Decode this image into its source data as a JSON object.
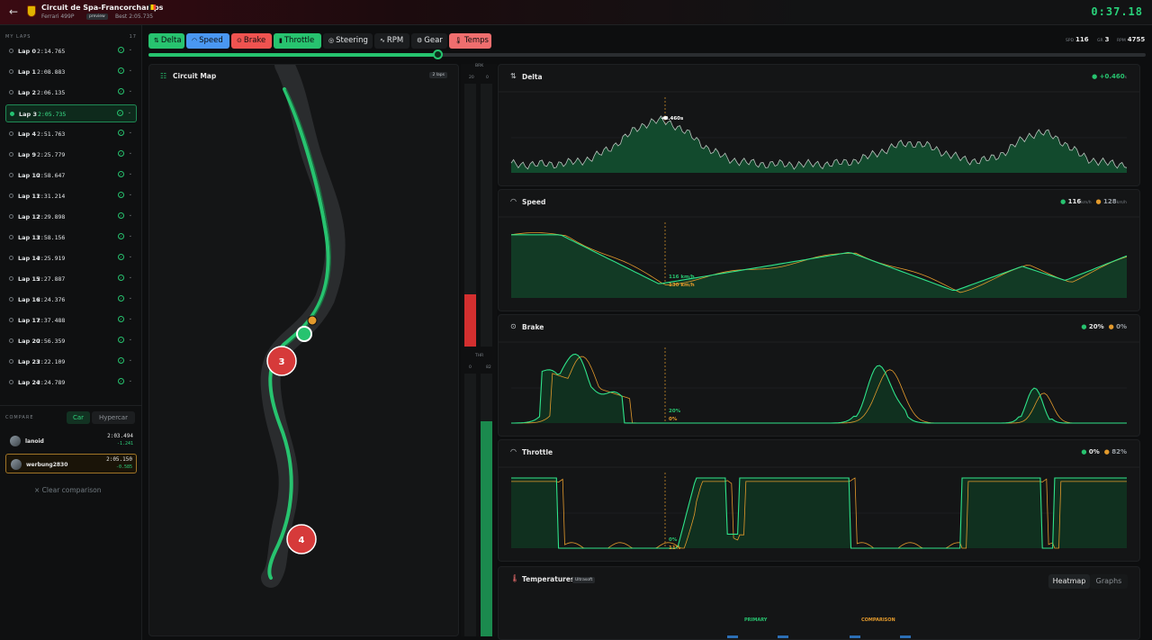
{
  "header": {
    "back_icon": "arrow-left-icon",
    "logo_icon": "ferrari-shield-icon",
    "title": "Circuit de Spa-Francorchamps",
    "car": "Ferrari 499P",
    "badge": "preview",
    "best": "Best 2:05.735",
    "clock": "0:37.18"
  },
  "sidebar": {
    "heading": "MY LAPS",
    "count": "17",
    "laps": [
      {
        "name": "Lap 0",
        "time": "2:14.765",
        "active": false
      },
      {
        "name": "Lap 1",
        "time": "2:08.883",
        "active": false
      },
      {
        "name": "Lap 2",
        "time": "2:06.135",
        "active": false
      },
      {
        "name": "Lap 3",
        "time": "2:05.735",
        "active": true
      },
      {
        "name": "Lap 4",
        "time": "2:51.763",
        "active": false
      },
      {
        "name": "Lap 9",
        "time": "2:25.779",
        "active": false
      },
      {
        "name": "Lap 10",
        "time": "2:58.647",
        "active": false
      },
      {
        "name": "Lap 11",
        "time": "2:31.214",
        "active": false
      },
      {
        "name": "Lap 12",
        "time": "2:29.898",
        "active": false
      },
      {
        "name": "Lap 13",
        "time": "2:58.156",
        "active": false
      },
      {
        "name": "Lap 14",
        "time": "2:25.919",
        "active": false
      },
      {
        "name": "Lap 15",
        "time": "2:27.887",
        "active": false
      },
      {
        "name": "Lap 16",
        "time": "2:24.376",
        "active": false
      },
      {
        "name": "Lap 17",
        "time": "2:37.488",
        "active": false
      },
      {
        "name": "Lap 20",
        "time": "2:56.359",
        "active": false
      },
      {
        "name": "Lap 23",
        "time": "2:22.109",
        "active": false
      },
      {
        "name": "Lap 24",
        "time": "2:24.789",
        "active": false
      }
    ]
  },
  "compare": {
    "label": "COMPARE",
    "tab_car": "Car",
    "tab_hyper": "Hypercar",
    "entries": [
      {
        "name": "lanoid",
        "time": "2:03.494",
        "diff": "-1.241",
        "selected": false
      },
      {
        "name": "werbung2830",
        "time": "2:05.150",
        "diff": "-0.585",
        "selected": true
      }
    ],
    "clear": "× Clear comparison"
  },
  "toolbar": {
    "buttons": [
      {
        "label": "Delta",
        "icon": "delta-icon",
        "color": "#27c36f",
        "on": true
      },
      {
        "label": "Speed",
        "icon": "gauge-icon",
        "color": "#4a97f2",
        "on": true
      },
      {
        "label": "Brake",
        "icon": "brake-icon",
        "color": "#ef5350",
        "on": true
      },
      {
        "label": "Throttle",
        "icon": "pedal-icon",
        "color": "#27c36f",
        "on": true
      },
      {
        "label": "Steering",
        "icon": "steering-icon",
        "color": "#1b1d1f",
        "on": false
      },
      {
        "label": "RPM",
        "icon": "pulse-icon",
        "color": "#1b1d1f",
        "on": false
      },
      {
        "label": "Gear",
        "icon": "gear-icon",
        "color": "#1b1d1f",
        "on": false
      },
      {
        "label": "Temps",
        "icon": "thermometer-icon",
        "color": "#ef6e6e",
        "on": true
      }
    ],
    "stats": {
      "speed_k": "SPD",
      "speed": "116",
      "gear_k": "GR",
      "gear": "3",
      "rpm_k": "RPM",
      "rpm": "4755"
    },
    "progress": 0.29
  },
  "map": {
    "title": "Circuit Map",
    "badge": "2 laps",
    "corner_a": "3",
    "corner_b": "4"
  },
  "pedals": {
    "brk_label": "BRK",
    "brk_a": "20",
    "brk_b": "0",
    "thr_label": "THR",
    "thr_a": "0",
    "thr_b": "82",
    "brake_primary": 0.2,
    "brake_comp": 0.0,
    "thr_primary": 0.0,
    "thr_comp": 0.82
  },
  "colors": {
    "primary": "#27c36f",
    "comparison": "#e39a2c",
    "accent_red": "#e53935"
  },
  "delta": {
    "title": "Delta",
    "legend": "+0.460",
    "unit": "s",
    "tag": "+0.460s"
  },
  "speed": {
    "title": "Speed",
    "primary": "116",
    "comparison": "128",
    "unit": "km/h",
    "tag_p": "116 km/h",
    "tag_c": "130 km/h"
  },
  "brake": {
    "title": "Brake",
    "primary": "20%",
    "comparison": "0%",
    "tag_p": "20%",
    "tag_c": "0%"
  },
  "throttle": {
    "title": "Throttle",
    "primary": "0%",
    "comparison": "82%",
    "tag_p": "0%",
    "tag_c": "11%"
  },
  "temps": {
    "title": "Temperatures",
    "badge": "Ultrasoft",
    "tab_heatmap": "Heatmap",
    "tab_graphs": "Graphs",
    "primary": "PRIMARY",
    "comparison": "COMPARISON"
  }
}
